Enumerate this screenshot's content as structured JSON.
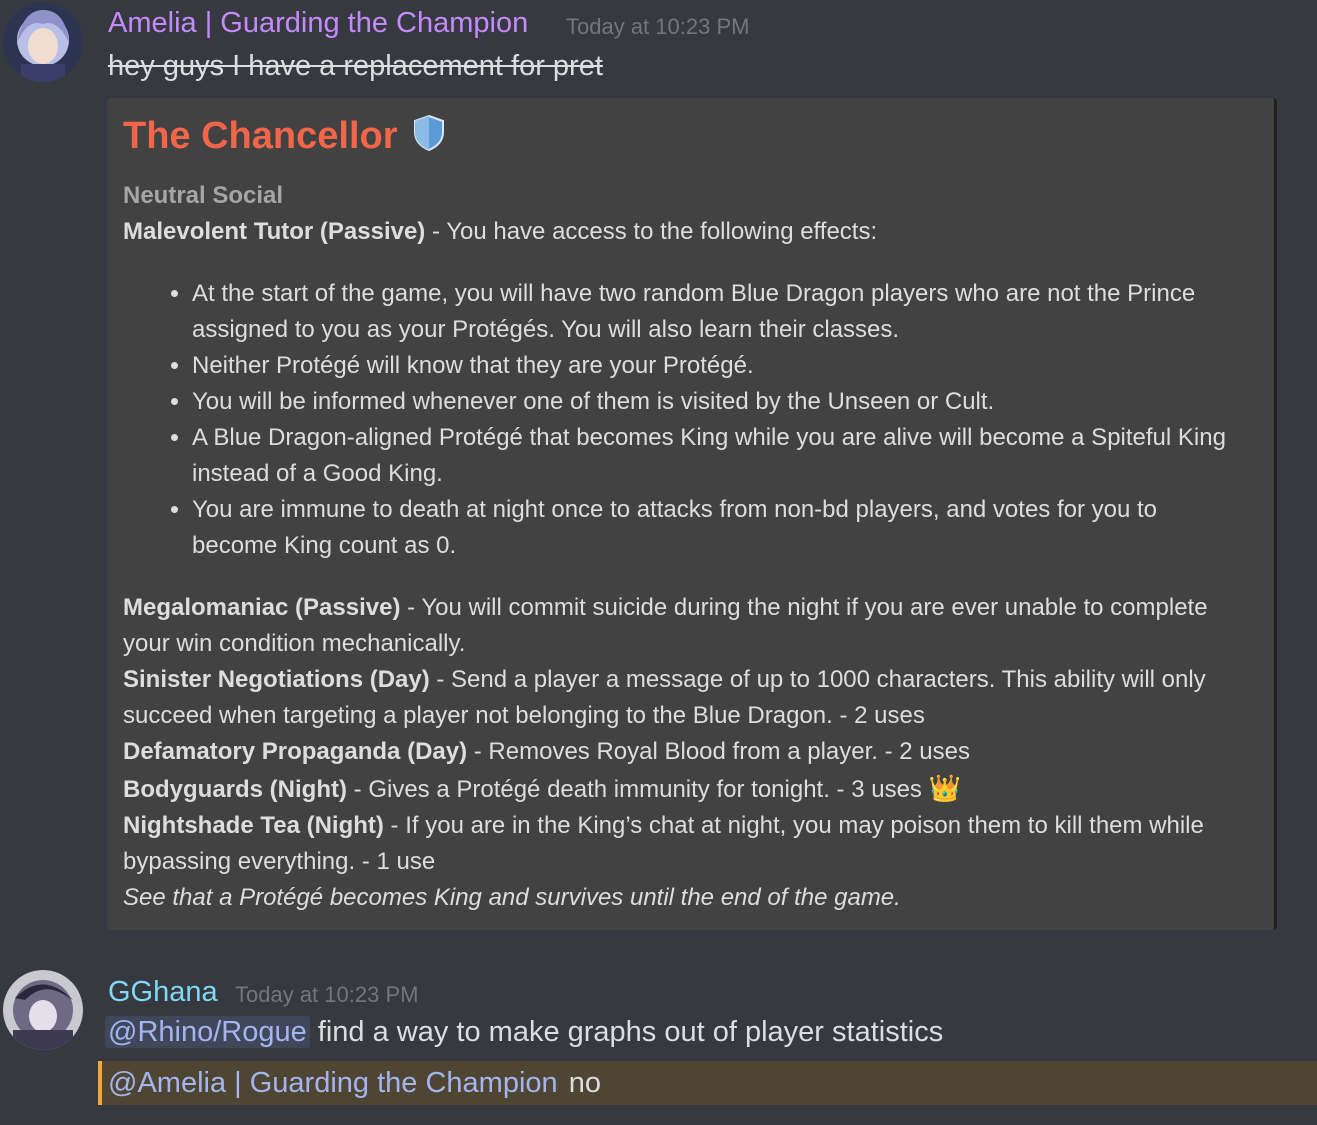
{
  "messages": [
    {
      "author": "Amelia | Guarding the Champion",
      "author_color": "#c58af9",
      "timestamp": "Today at 10:23 PM",
      "text": "hey guys I have a replacement for pret",
      "embed": {
        "title": "The Chancellor",
        "title_icon": "shield-icon",
        "subtitle": "Neutral Social",
        "passive1_name": "Malevolent Tutor (Passive)",
        "passive1_text": " - You have access to the following effects:",
        "bullets": [
          "At the start of the game, you will have two random Blue Dragon players who are not the Prince assigned to you as your Protégés. You will also learn their classes.",
          "Neither Protégé will know that they are your Protégé.",
          "You will be informed whenever one of them is visited by the Unseen or Cult.",
          "A Blue Dragon-aligned Protégé that becomes King while you are alive will become a Spiteful King instead of a Good King.",
          "You are immune to death at night once to attacks from non-bd players, and votes for you to become King count as 0."
        ],
        "abilities": [
          {
            "name": "Megalomaniac (Passive)",
            "text": " - You will commit suicide during the night if you are ever unable to complete your win condition mechanically."
          },
          {
            "name": "Sinister Negotiations (Day)",
            "text": " - Send a player a message of up to 1000 characters. This ability will only succeed when targeting a player not belonging to the Blue Dragon. - 2 uses"
          },
          {
            "name": "Defamatory Propaganda (Day)",
            "text": " - Removes Royal Blood from a player. - 2 uses"
          },
          {
            "name": "Bodyguards (Night)",
            "text": " - Gives a Protégé death immunity for tonight. - 3 uses ",
            "emoji": "👑"
          },
          {
            "name": "Nightshade Tea (Night)",
            "text": " - If you are in the King’s chat at night, you may poison them to kill them while bypassing everything. - 1 use"
          }
        ],
        "goal": "See that a Protégé becomes King and survives until the end of the game."
      }
    },
    {
      "author": "GGhana",
      "author_color": "#7fd9f5",
      "timestamp": "Today at 10:23 PM",
      "mention1": "@Rhino/Rogue",
      "text1": " find a way to make graphs out of player statistics",
      "mention2": "@Amelia | Guarding the Champion",
      "text2": " no"
    }
  ]
}
